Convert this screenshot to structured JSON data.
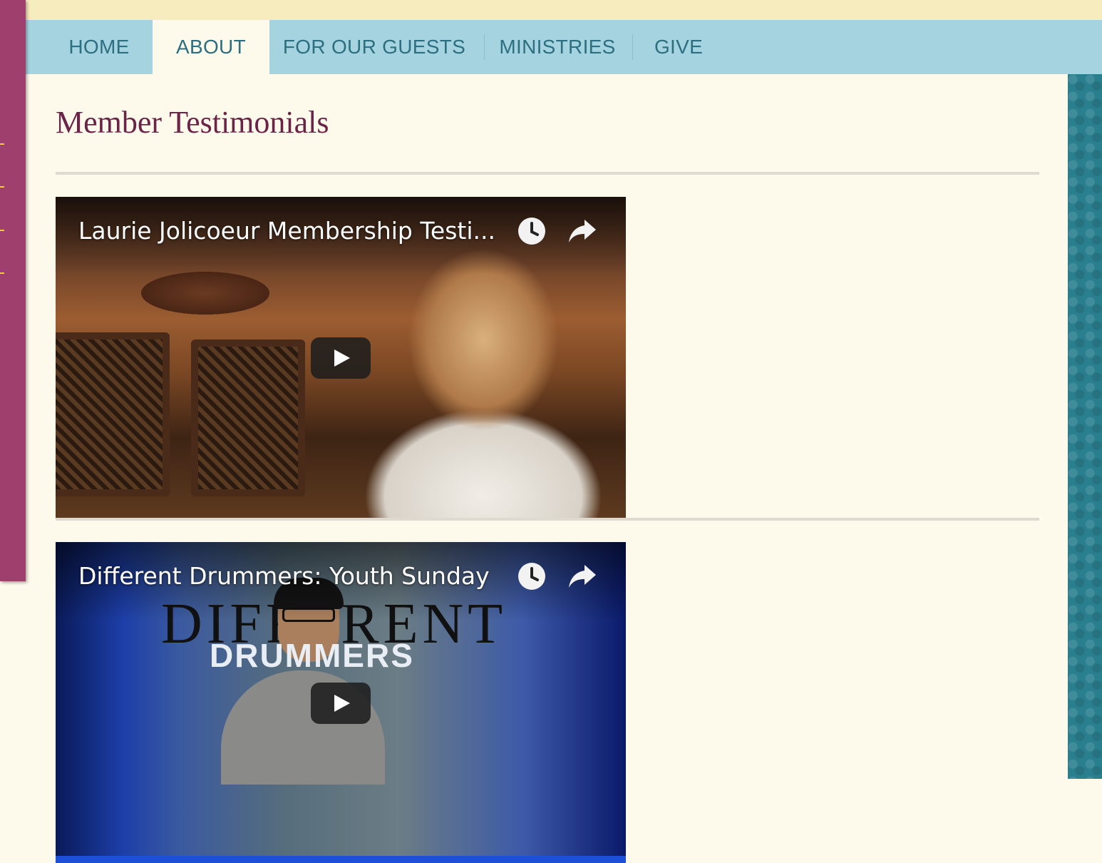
{
  "nav": {
    "items": [
      {
        "label": "HOME"
      },
      {
        "label": "ABOUT",
        "active": true
      },
      {
        "label": "FOR OUR GUESTS"
      },
      {
        "label": "MINISTRIES"
      },
      {
        "label": "GIVE"
      }
    ]
  },
  "page": {
    "title": "Member Testimonials"
  },
  "videos": [
    {
      "title": "Laurie Jolicoeur Membership Testi...",
      "icons": [
        "watch-later-icon",
        "share-icon",
        "play-icon"
      ]
    },
    {
      "title": "Different Drummers: Youth Sunday",
      "thumbnail_text": [
        "DIFFERENT",
        "DRUMMERS"
      ],
      "icons": [
        "watch-later-icon",
        "share-icon",
        "play-icon"
      ]
    }
  ],
  "colors": {
    "nav_background": "#a5d4e0",
    "nav_text": "#2d6f80",
    "title": "#6b2447",
    "sidebar": "#9f3f6e",
    "page_background": "#fdfaeb",
    "right_bar": "#2a7f8f",
    "top_strip": "#f7ecbe"
  }
}
